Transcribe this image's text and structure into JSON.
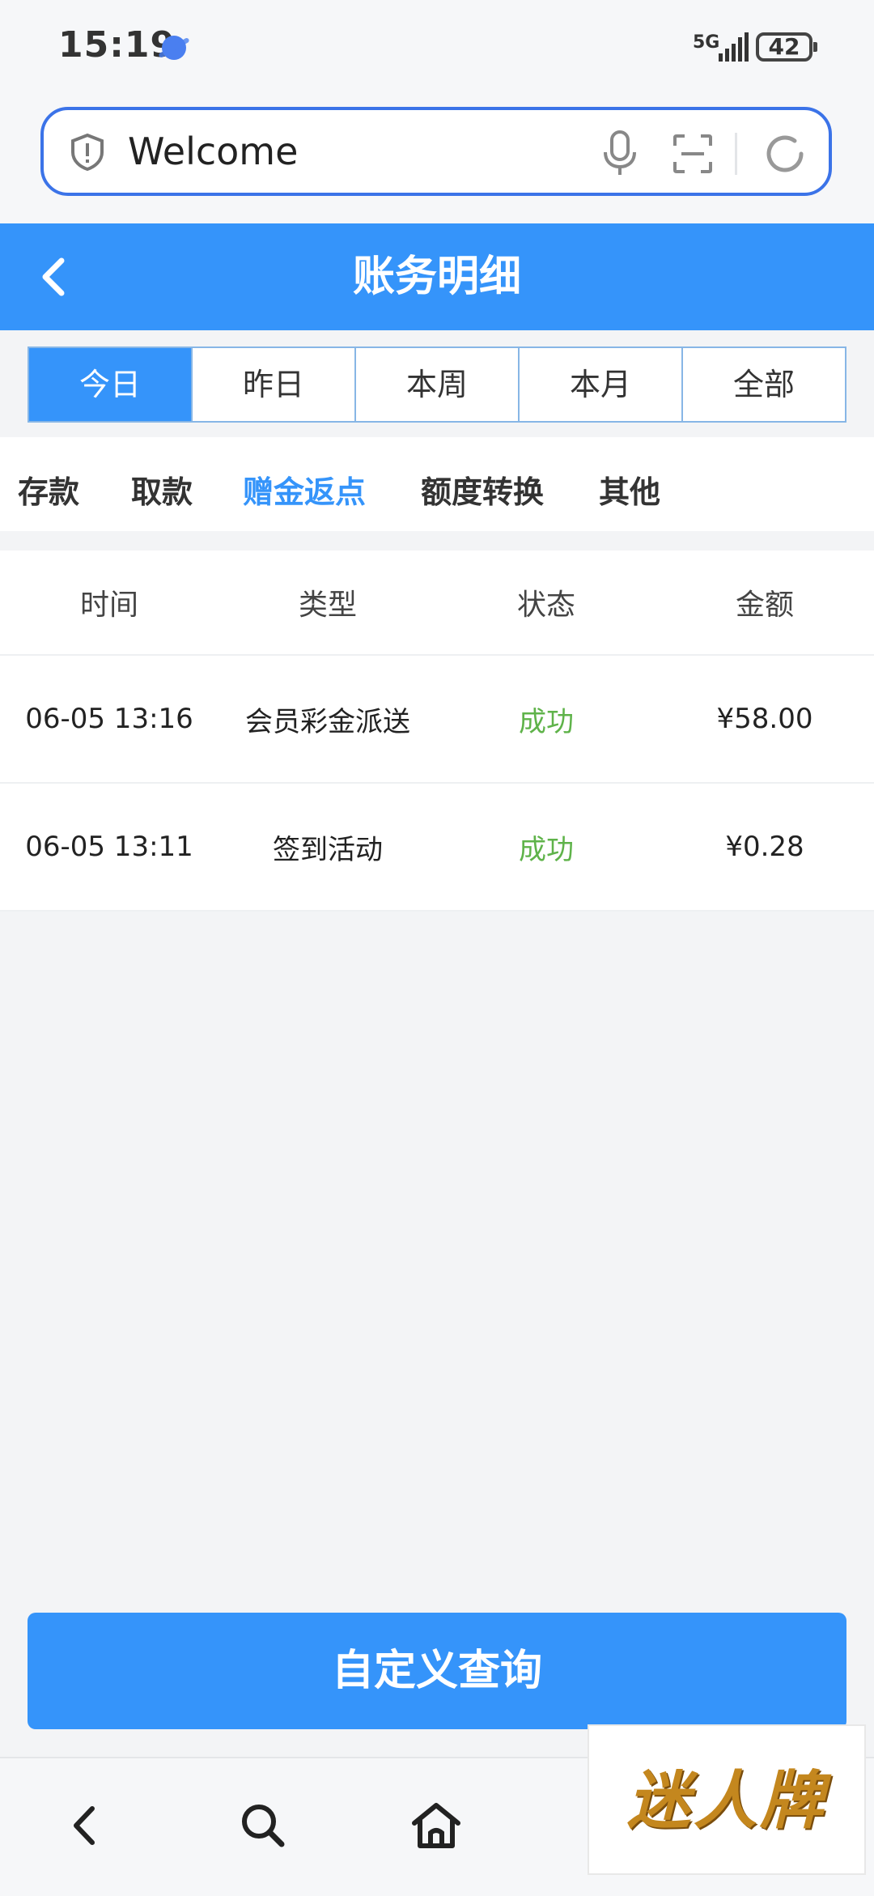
{
  "status_bar": {
    "time": "15:19",
    "network": "5G",
    "battery": "42"
  },
  "browser": {
    "address": "Welcome"
  },
  "header": {
    "title": "账务明细"
  },
  "date_tabs": [
    {
      "label": "今日",
      "active": true
    },
    {
      "label": "昨日",
      "active": false
    },
    {
      "label": "本周",
      "active": false
    },
    {
      "label": "本月",
      "active": false
    },
    {
      "label": "全部",
      "active": false
    }
  ],
  "categories": [
    {
      "label": "存款",
      "active": false
    },
    {
      "label": "取款",
      "active": false
    },
    {
      "label": "赠金返点",
      "active": true
    },
    {
      "label": "额度转换",
      "active": false
    },
    {
      "label": "其他",
      "active": false
    }
  ],
  "table": {
    "headers": [
      "时间",
      "类型",
      "状态",
      "金额"
    ],
    "rows": [
      {
        "time": "06-05 13:16",
        "type": "会员彩金派送",
        "status": "成功",
        "amount": "¥58.00"
      },
      {
        "time": "06-05 13:11",
        "type": "签到活动",
        "status": "成功",
        "amount": "¥0.28"
      }
    ]
  },
  "query_button": "自定义查询",
  "watermark": "迷人牌",
  "colors": {
    "primary": "#3594fa",
    "success": "#5fb34a",
    "background": "#f3f4f6"
  }
}
